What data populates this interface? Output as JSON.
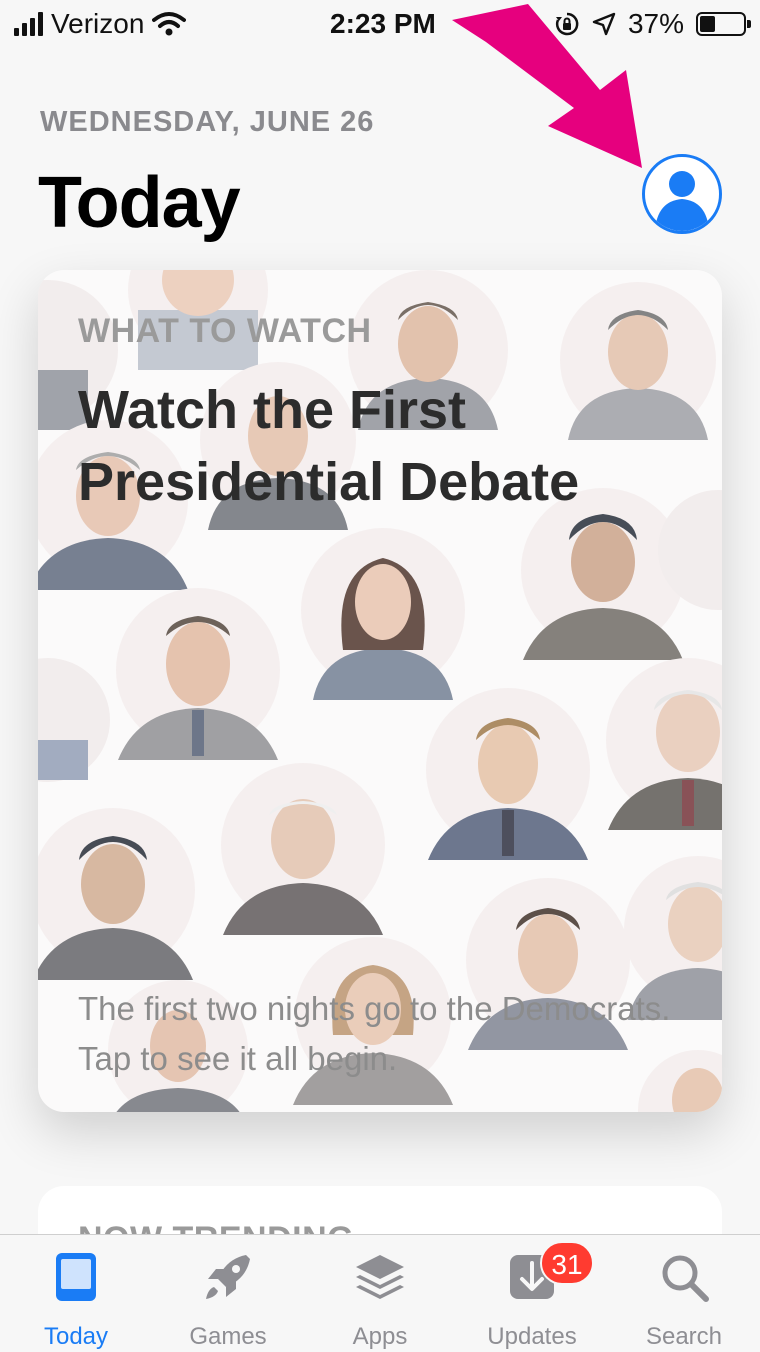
{
  "status_bar": {
    "carrier": "Verizon",
    "time": "2:23 PM",
    "battery_percent": "37%",
    "battery_level": 0.37,
    "icons": [
      "signal-bars-icon",
      "wifi-icon",
      "orientation-lock-icon",
      "location-arrow-icon",
      "battery-icon"
    ]
  },
  "header": {
    "date": "WEDNESDAY, JUNE 26",
    "title": "Today",
    "account_icon": "account-person-icon"
  },
  "annotation": {
    "color": "#e6007e",
    "icon": "pointer-arrow-icon"
  },
  "feature_card": {
    "eyebrow": "WHAT TO WATCH",
    "title": "Watch the First Presidential Debate",
    "description": "The first two nights go to the Democrats. Tap to see it all begin."
  },
  "next_card": {
    "eyebrow": "NOW TRENDING"
  },
  "tab_bar": {
    "accent": "#1a7cf5",
    "tabs": [
      {
        "label": "Today",
        "icon": "today-icon",
        "active": true
      },
      {
        "label": "Games",
        "icon": "rocket-icon",
        "active": false
      },
      {
        "label": "Apps",
        "icon": "layers-icon",
        "active": false
      },
      {
        "label": "Updates",
        "icon": "download-icon",
        "active": false,
        "badge": "31"
      },
      {
        "label": "Search",
        "icon": "search-icon",
        "active": false
      }
    ]
  }
}
